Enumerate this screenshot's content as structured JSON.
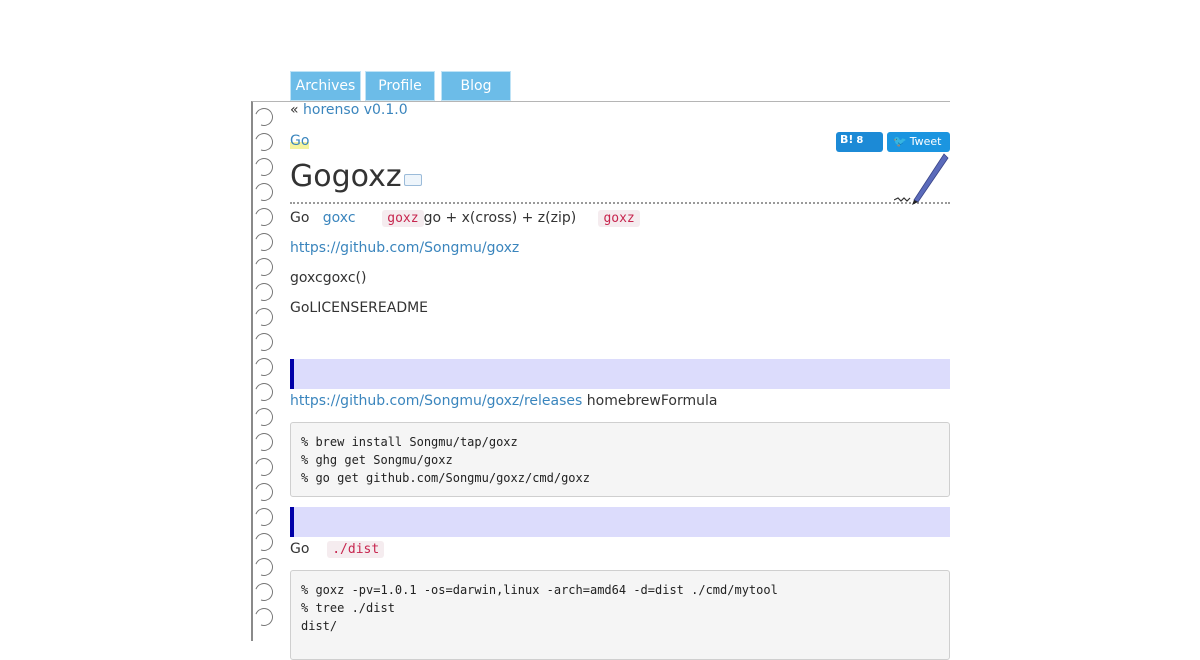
{
  "nav": {
    "tabs": [
      {
        "label": "Archives"
      },
      {
        "label": "Profile"
      },
      {
        "label": "Blog"
      }
    ]
  },
  "entry": {
    "prev_marker": "«",
    "prev_link": "horenso v0.1.0",
    "category": "Go",
    "hatena_label": "B!",
    "hatena_count": "8",
    "tweet_label": "Tweet",
    "title": "Gogoxz"
  },
  "body": {
    "line1": {
      "t1": "Go",
      "link": "goxc",
      "code": "goxz",
      "t2": "go + x(cross) + z(zip)",
      "code2": "goxz"
    },
    "repo_link": "https://github.com/Songmu/goxz",
    "line3": "goxcgoxc()",
    "line4": "GoLICENSEREADME",
    "releases_link": "https://github.com/Songmu/goxz/releases",
    "releases_text": "homebrewFormula",
    "code_block1": [
      "% brew install Songmu/tap/goxz",
      "% ghg get Songmu/goxz",
      "% go get github.com/Songmu/goxz/cmd/goxz"
    ],
    "line_dist": {
      "t": "Go",
      "code": "./dist"
    },
    "code_block2": [
      "% goxz -pv=1.0.1 -os=darwin,linux -arch=amd64 -d=dist ./cmd/mytool",
      "% tree ./dist",
      "dist/"
    ]
  },
  "colors": {
    "nav_tab": "#6cbce8",
    "link": "#3a85bd",
    "section_bar": "#dcdcfc",
    "section_accent": "#0000a8",
    "inline_code": "#c7254e"
  },
  "icons": [
    "notebook-ring-icon",
    "edit-icon",
    "pen-icon",
    "twitter-bird-icon"
  ]
}
